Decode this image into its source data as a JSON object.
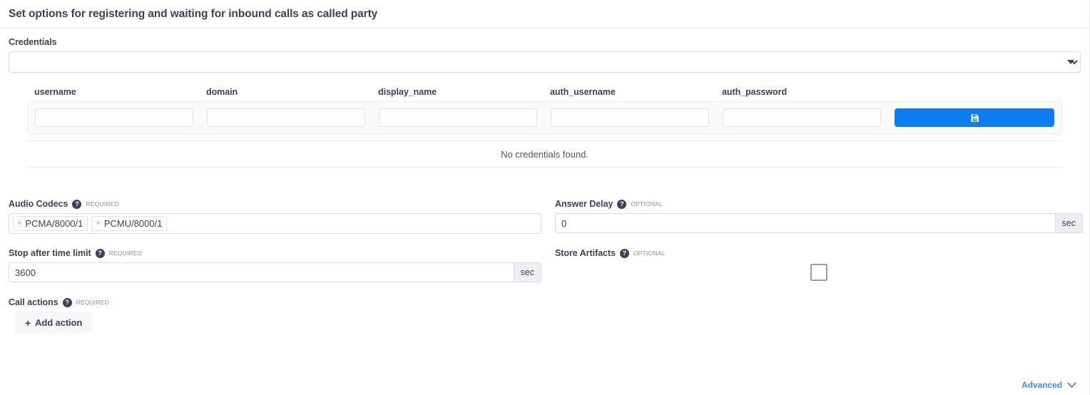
{
  "header": {
    "title": "Set options for registering and waiting for inbound calls as called party"
  },
  "credentials": {
    "label": "Credentials",
    "select_value": "",
    "select_placeholder": "",
    "caret_icon": "chevron-down-icon",
    "columns": [
      "username",
      "domain",
      "display_name",
      "auth_username",
      "auth_password"
    ],
    "new_row": {
      "username": "",
      "domain": "",
      "display_name": "",
      "auth_username": "",
      "auth_password": ""
    },
    "save_icon": "save-icon",
    "empty_message": "No credentials found."
  },
  "fields": {
    "audio_codecs": {
      "label": "Audio Codecs",
      "help_icon": "help-icon",
      "requirement": "REQUIRED",
      "tags": [
        "PCMA/8000/1",
        "PCMU/8000/1"
      ],
      "remove_glyph": "×"
    },
    "answer_delay": {
      "label": "Answer Delay",
      "help_icon": "help-icon",
      "requirement": "OPTIONAL",
      "value": "0",
      "unit": "sec"
    },
    "stop_after_time_limit": {
      "label": "Stop after time limit",
      "help_icon": "help-icon",
      "requirement": "REQUIRED",
      "value": "3600",
      "unit": "sec"
    },
    "store_artifacts": {
      "label": "Store Artifacts",
      "help_icon": "help-icon",
      "requirement": "OPTIONAL",
      "checked": false
    },
    "call_actions": {
      "label": "Call actions",
      "help_icon": "help-icon",
      "requirement": "REQUIRED",
      "add_button_label": "Add action",
      "plus_glyph": "+"
    }
  },
  "footer": {
    "advanced_label": "Advanced",
    "chevron_icon": "chevron-down-icon"
  },
  "colors": {
    "accent_blue": "#0b7ef4",
    "link_blue": "#3d8ef7",
    "text": "#3c4257",
    "muted": "#8a909c",
    "border": "#d8dbe0"
  },
  "help_glyph": "?"
}
